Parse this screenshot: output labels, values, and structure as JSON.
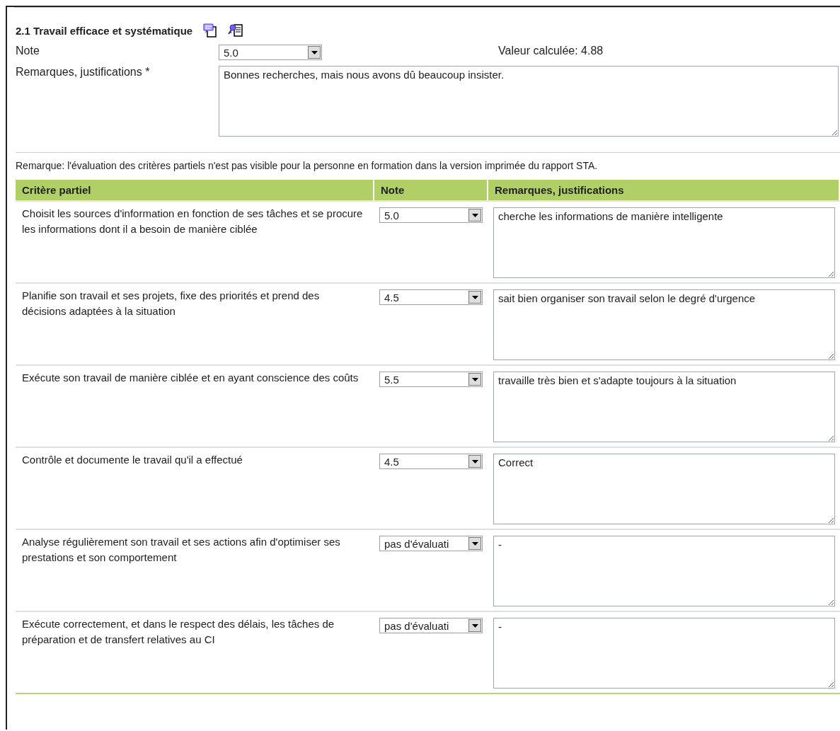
{
  "section": {
    "title": "2.1 Travail efficace et systématique",
    "note_label": "Note",
    "note_value": "5.0",
    "calculated": "Valeur calculée: 4.88",
    "remarks_label": "Remarques, justifications *",
    "remarks_value": "Bonnes recherches, mais nous avons dû beaucoup insister."
  },
  "notice": "Remarque: l'évaluation des critères partiels n'est pas visible pour la personne en formation dans la version imprimée du rapport STA.",
  "table": {
    "columns": [
      "Critère partiel",
      "Note",
      "Remarques, justifications"
    ],
    "rows": [
      {
        "criterion": "Choisit les sources d'information en fonction de ses tâches et se procure les informations dont il a besoin de manière ciblée",
        "note": "5.0",
        "remarks": "cherche les informations de manière intelligente"
      },
      {
        "criterion": "Planifie son travail et ses projets, fixe des priorités et prend des décisions adaptées à la situation",
        "note": "4.5",
        "remarks": "sait bien organiser son travail selon le degré d'urgence"
      },
      {
        "criterion": "Exécute son travail de manière ciblée et en ayant conscience des coûts",
        "note": "5.5",
        "remarks": "travaille très bien et s'adapte toujours à la situation"
      },
      {
        "criterion": "Contrôle et documente le travail qu'il a effectué",
        "note": "4.5",
        "remarks": "Correct"
      },
      {
        "criterion": "Analyse régulièrement son travail et ses actions afin d'optimiser ses prestations et son comportement",
        "note": "pas d'évaluati",
        "remarks": "-"
      },
      {
        "criterion": "Exécute correctement, et dans le respect des délais, les tâches de préparation et de transfert relatives au CI",
        "note": "pas d'évaluati",
        "remarks": "-"
      }
    ]
  }
}
